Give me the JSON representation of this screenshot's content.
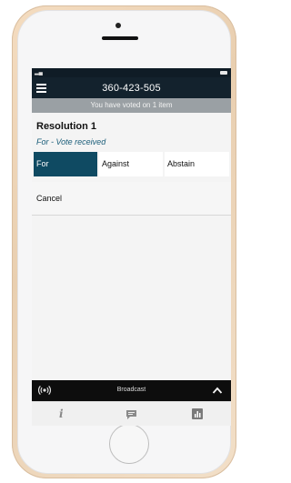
{
  "header": {
    "title": "360-423-505"
  },
  "banner": {
    "text": "You have voted on 1 item"
  },
  "resolution": {
    "title": "Resolution 1",
    "status": "For - Vote received",
    "options": [
      "For",
      "Against",
      "Abstain"
    ],
    "selected": "For",
    "cancel_label": "Cancel"
  },
  "broadcast": {
    "label": "Broadcast"
  },
  "colors": {
    "header_bg": "#13222d",
    "selected_option": "#0f4a62",
    "banner_bg": "#9aa0a4",
    "status_text": "#1a5d79"
  },
  "icons": {
    "menu": "hamburger-icon",
    "broadcast": "broadcast-icon",
    "expand": "chevron-up-icon",
    "nav": [
      "info-icon",
      "chat-icon",
      "bar-chart-icon"
    ]
  }
}
